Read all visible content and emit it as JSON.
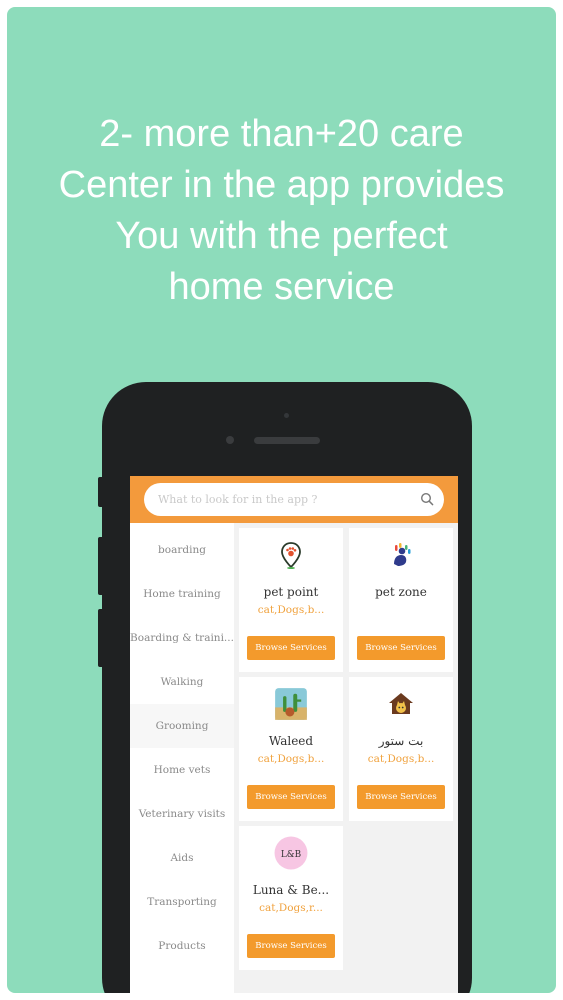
{
  "headline": {
    "line1": "2- more than+20 care",
    "line2": "Center in the app provides",
    "line3": "You with the perfect",
    "line4": "home service"
  },
  "search": {
    "placeholder": "What to look for in the app ?",
    "icon": "search-icon"
  },
  "categories": [
    {
      "label": "boarding"
    },
    {
      "label": "Home training"
    },
    {
      "label": "Boarding & traini..."
    },
    {
      "label": "Walking"
    },
    {
      "label": "Grooming"
    },
    {
      "label": "Home vets"
    },
    {
      "label": "Veterinary visits"
    },
    {
      "label": "Aids"
    },
    {
      "label": "Transporting"
    },
    {
      "label": "Products"
    }
  ],
  "selected_category": "Grooming",
  "centers": [
    {
      "name": "pet point",
      "tags": "cat,Dogs,b...",
      "button": "Browse Services",
      "icon": "paw-pin-icon"
    },
    {
      "name": "pet zone",
      "tags": "",
      "button": "Browse Services",
      "icon": "dog-hand-logo-icon"
    },
    {
      "name": "Waleed",
      "tags": "cat,Dogs,b...",
      "button": "Browse Services",
      "icon": "cactus-photo-icon"
    },
    {
      "name": "بت ستور",
      "tags": "cat,Dogs,b...",
      "button": "Browse Services",
      "icon": "house-cat-icon"
    },
    {
      "name": "Luna & Be...",
      "tags": "cat,Dogs,r...",
      "button": "Browse Services",
      "icon": "luna-logo-icon",
      "logo_text": "L&B"
    }
  ],
  "colors": {
    "background": "#8ddcbb",
    "accent": "#f39a2c",
    "tag_text": "#f0a23e",
    "phone": "#1f2122"
  }
}
